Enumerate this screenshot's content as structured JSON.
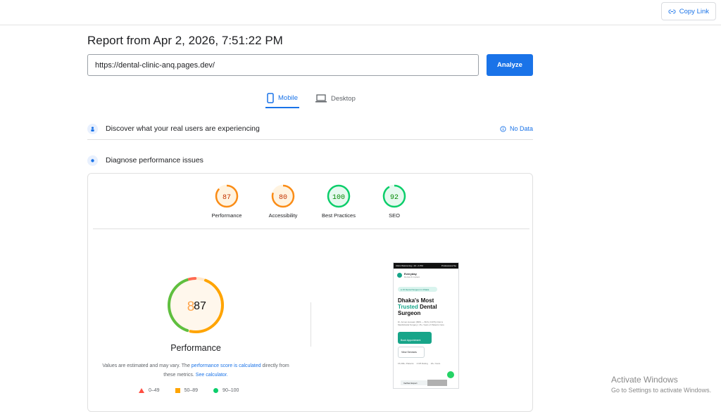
{
  "header": {
    "copy_link_label": "Copy Link"
  },
  "report": {
    "title": "Report from Apr 2, 2026, 7:51:22 PM"
  },
  "search": {
    "url_value": "https://dental-clinic-anq.pages.dev/",
    "analyze_label": "Analyze"
  },
  "tabs": [
    {
      "label": "Mobile",
      "active": true
    },
    {
      "label": "Desktop",
      "active": false
    }
  ],
  "sections": {
    "field_data": {
      "title": "Discover what your real users are experiencing",
      "status": "No Data"
    },
    "diagnose": {
      "title": "Diagnose performance issues"
    }
  },
  "scores": [
    {
      "label": "Performance",
      "value": "87",
      "color": "#fa8c16"
    },
    {
      "label": "Accessibility",
      "value": "80",
      "color": "#fa8c16"
    },
    {
      "label": "Best Practices",
      "value": "100",
      "color": "#0cce6b"
    },
    {
      "label": "SEO",
      "value": "92",
      "color": "#0cce6b"
    }
  ],
  "performance": {
    "score_ghost": "8",
    "score": "87",
    "label": "Performance",
    "note_prefix": "Values are estimated and may vary. The ",
    "note_link1": "performance score is calculated",
    "note_middle": " directly from these metrics. ",
    "note_link2": "See calculator.",
    "legend": [
      {
        "label": "0–49",
        "color": "#ff4e42"
      },
      {
        "label": "50–89",
        "color": "#ffa400"
      },
      {
        "label": "90–100",
        "color": "#0cce6b"
      }
    ]
  },
  "preview": {
    "status_left": "Clinic Welcoming • 10 • 4 PM",
    "status_right": "Professional Se",
    "brand": "Everyday",
    "brand_sub": "Dental & Implant",
    "pill": "● 15 Dental Surgeon in Dhaka",
    "headline_1": "Dhaka's Most",
    "headline_teal": "Trusted",
    "headline_2": "Dental",
    "headline_3": "Surgeon",
    "para": "Dr. Arman Hossain (BDS — BCS, FCPS) Oral & Maxillofacial Surgery | 15+ Years of Patients Care",
    "btn_primary": "Book Appointment",
    "btn_secondary": "View Services",
    "stats": [
      "15,000+ Patients",
      "4.9/5 Rating",
      "20+ Years"
    ],
    "foot": "Verified Expert"
  },
  "watermark": {
    "line1": "Activate Windows",
    "line2": "Go to Settings to activate Windows."
  }
}
